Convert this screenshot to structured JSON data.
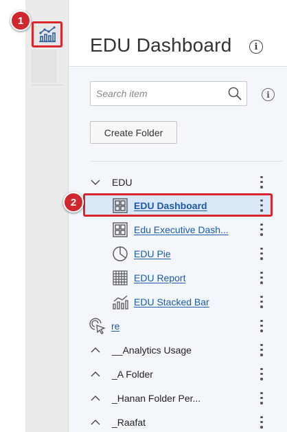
{
  "header": {
    "title": "EDU Dashboard",
    "info_icon": "info-icon"
  },
  "rail": {
    "active_icon": "analytics-chart-icon"
  },
  "markers": [
    "1",
    "2"
  ],
  "search": {
    "placeholder": "Search item",
    "icon": "search-icon"
  },
  "toolbar": {
    "create_folder_label": "Create Folder",
    "info_icon": "info-icon"
  },
  "tree": {
    "root": {
      "label": "EDU",
      "expanded": true
    },
    "children": [
      {
        "label": "EDU Dashboard",
        "icon": "dashboard-icon",
        "selected": true
      },
      {
        "label": "Edu Executive Dash...",
        "icon": "dashboard-icon"
      },
      {
        "label": "EDU Pie",
        "icon": "pie-chart-icon"
      },
      {
        "label": "EDU Report",
        "icon": "report-grid-icon"
      },
      {
        "label": "EDU Stacked Bar",
        "icon": "bar-chart-icon"
      }
    ],
    "loose_item": {
      "label": "re",
      "icon": "cursor-click-icon"
    },
    "folders": [
      {
        "label": "__Analytics Usage"
      },
      {
        "label": "_A Folder"
      },
      {
        "label": "_Hanan Folder Per..."
      },
      {
        "label": "_Raafat"
      }
    ]
  },
  "colors": {
    "accent_red": "#d8262c",
    "link_blue": "#1b5aa8",
    "selected_bg": "#d9e7f7",
    "panel_bg": "#f3f6fa",
    "rail_bg": "#ebebeb"
  }
}
